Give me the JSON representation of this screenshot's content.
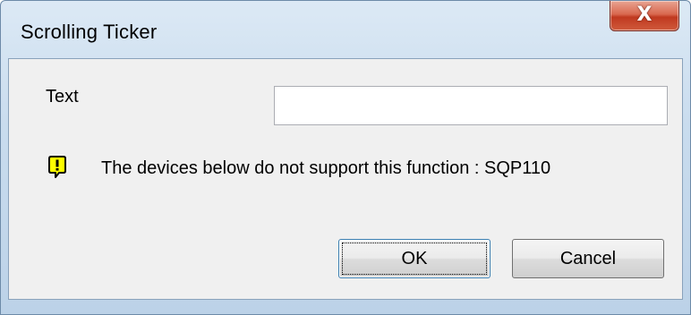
{
  "dialog": {
    "title": "Scrolling Ticker",
    "close_symbol": "X"
  },
  "form": {
    "text_label": "Text",
    "text_value": "",
    "text_placeholder": ""
  },
  "warning": {
    "icon": "exclamation-warning-icon",
    "icon_color": "#ffff00",
    "message": "The devices below do not support this function : SQP110"
  },
  "buttons": {
    "ok_label": "OK",
    "cancel_label": "Cancel"
  }
}
